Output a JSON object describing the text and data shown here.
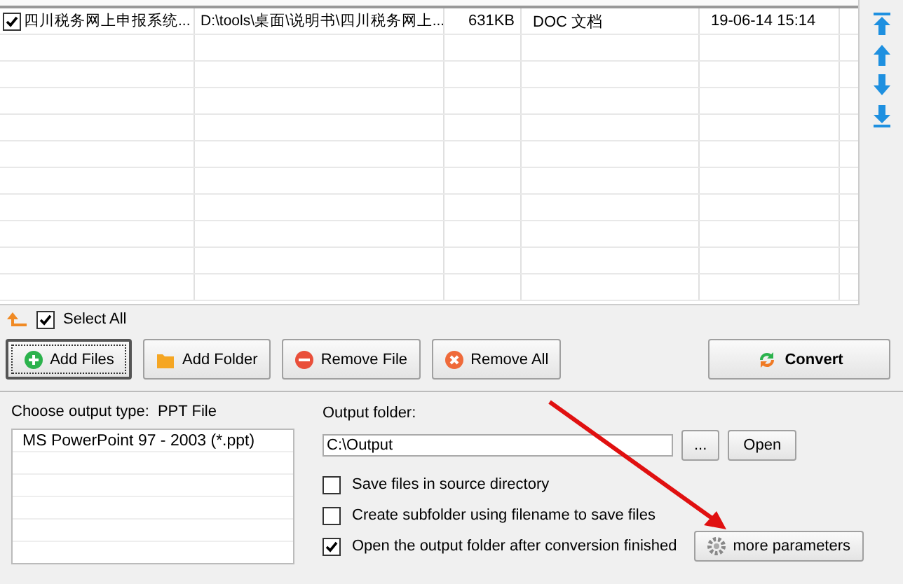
{
  "file_list": {
    "rows": [
      {
        "checked": true,
        "file_name": "四川税务网上申报系统...",
        "path": "D:\\tools\\桌面\\说明书\\四川税务网上...",
        "size": "631KB",
        "file_type": "DOC 文档",
        "modify_date": "19-06-14 15:14"
      }
    ]
  },
  "select_all": {
    "label": "Select All",
    "checked": true
  },
  "buttons": [
    {
      "kind": "add",
      "label": "Add Files",
      "focused": true
    },
    {
      "kind": "folder",
      "label": "Add Folder",
      "focused": false
    },
    {
      "kind": "remove",
      "label": "Remove File",
      "focused": false
    },
    {
      "kind": "clear",
      "label": "Remove All",
      "focused": false
    }
  ],
  "convert": {
    "label": "Convert"
  },
  "output_type": {
    "label": "Choose output type:",
    "value": "PPT File",
    "options": [
      {
        "label": "MS PowerPoint 97 - 2003 (*.ppt)"
      }
    ]
  },
  "output_folder": {
    "label": "Output folder:",
    "value": "C:\\Output",
    "browse": "...",
    "open": "Open"
  },
  "options": [
    {
      "label": "Save files in source directory",
      "checked": false
    },
    {
      "label": "Create subfolder using filename to save files",
      "checked": false
    },
    {
      "label": "Open the output folder after conversion finished",
      "checked": true
    }
  ],
  "more_button": {
    "label": "more parameters"
  }
}
